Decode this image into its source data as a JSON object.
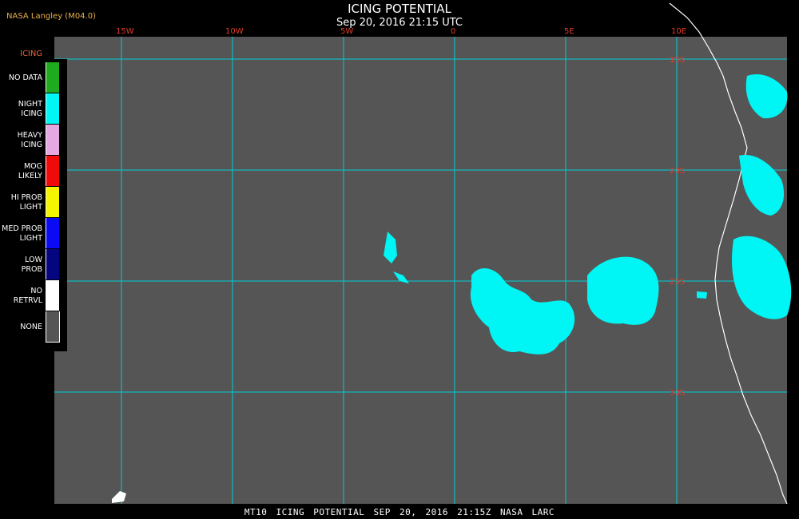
{
  "header": {
    "source": "NASA Langley (M04.0)",
    "title": "ICING POTENTIAL",
    "subtitle": "Sep 20, 2016 21:15 UTC"
  },
  "legend": {
    "title": "ICING",
    "items": [
      {
        "label": "NO DATA",
        "color": "#1faa1f"
      },
      {
        "label": "NIGHT\nICING",
        "color": "#00f5f5"
      },
      {
        "label": "HEAVY\nICING",
        "color": "#e6a8e0"
      },
      {
        "label": "MOG\nLIKELY",
        "color": "#f00a0a"
      },
      {
        "label": "HI PROB\nLIGHT",
        "color": "#f5f500"
      },
      {
        "label": "MED PROB\nLIGHT",
        "color": "#0a0af5"
      },
      {
        "label": "LOW\nPROB",
        "color": "#050580"
      },
      {
        "label": "NO\nRETRVL",
        "color": "#ffffff"
      },
      {
        "label": "NONE",
        "color": "#555555"
      }
    ]
  },
  "map": {
    "grid_color": "#00cfd6",
    "label_color": "#e43b2a",
    "longitudes": [
      "15W",
      "10W",
      "5W",
      "0",
      "5E",
      "10E"
    ],
    "latitudes": [
      "15S",
      "20S",
      "25S",
      "30S"
    ]
  },
  "footer": {
    "caption": "MT10  ICING POTENTIAL  SEP 20, 2016 21:15Z  NASA LARC"
  }
}
